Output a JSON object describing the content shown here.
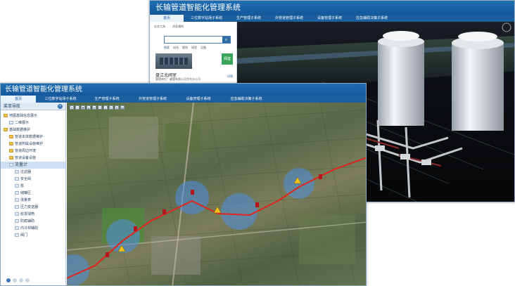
{
  "back_window": {
    "title": "长输管道智能化管理系统",
    "nav": [
      "首页",
      "三位数字站场子系统",
      "生产管理子系统",
      "外管道管理子系统",
      "设备管理子系统",
      "应急辅助决策子系统"
    ],
    "actions": [
      "业务工具",
      "消息通知"
    ],
    "search_label": "搜索",
    "search_links": [
      "站场",
      "管线",
      "阀室",
      "设备"
    ],
    "station_title": "盘江北阀室",
    "station_sub": "管理单位：输管有限公司华东分公司",
    "station_badge": "阀室",
    "detail_link": "详情",
    "colors": {
      "title_bar": "#1a63a6",
      "tank": "#e8ecef"
    }
  },
  "front_window": {
    "title": "长输管道智能化管理系统",
    "nav": [
      "首页",
      "三位数字站场子系统",
      "生产管理子系统",
      "外管道管理子系统",
      "设备管理子系统",
      "应急辅助决策子系统"
    ],
    "sidebar_title": "菜单导航",
    "tree": [
      {
        "label": "地图基础信息展示",
        "level": 0,
        "type": "folder"
      },
      {
        "label": "二维展示",
        "level": 1,
        "type": "doc"
      },
      {
        "label": "基础数据维护",
        "level": 0,
        "type": "folder"
      },
      {
        "label": "管道本体数据维护",
        "level": 1,
        "type": "folder"
      },
      {
        "label": "管道附属设施维护",
        "level": 1,
        "type": "folder"
      },
      {
        "label": "管道周边环境",
        "level": 1,
        "type": "folder"
      },
      {
        "label": "管道设备设施",
        "level": 1,
        "type": "folder"
      },
      {
        "label": "流量计",
        "level": 1,
        "type": "doc",
        "selected": true
      },
      {
        "label": "过滤器",
        "level": 2,
        "type": "doc"
      },
      {
        "label": "安全阀",
        "level": 2,
        "type": "doc"
      },
      {
        "label": "泵",
        "level": 2,
        "type": "doc"
      },
      {
        "label": "储罐区",
        "level": 2,
        "type": "doc"
      },
      {
        "label": "流量表",
        "level": 2,
        "type": "doc"
      },
      {
        "label": "压力变送器",
        "level": 2,
        "type": "doc"
      },
      {
        "label": "收发球筒",
        "level": 2,
        "type": "doc"
      },
      {
        "label": "防腐辅助",
        "level": 2,
        "type": "doc"
      },
      {
        "label": "内冷却辅助",
        "level": 2,
        "type": "doc"
      },
      {
        "label": "阀门",
        "level": 2,
        "type": "doc"
      }
    ],
    "pager_count": 4
  }
}
